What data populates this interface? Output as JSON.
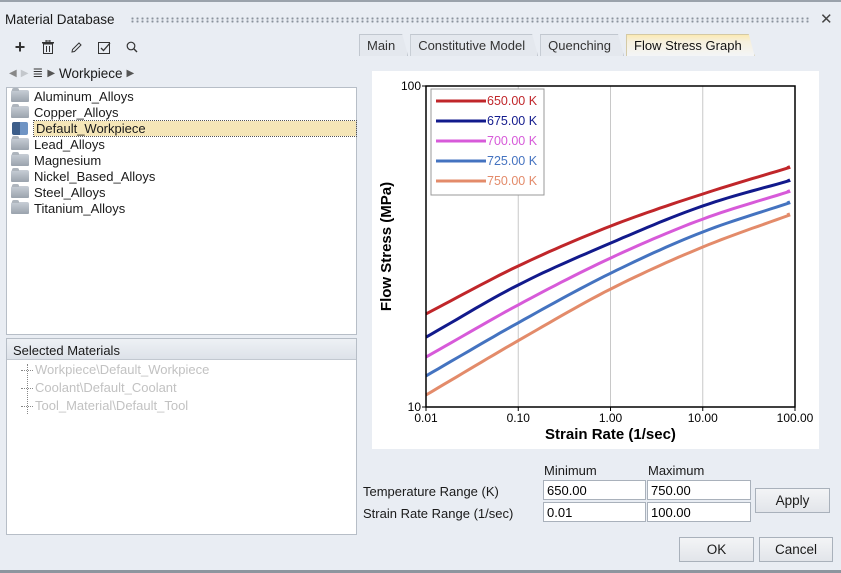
{
  "window": {
    "title": "Material Database",
    "close_icon": "close-icon"
  },
  "toolbar": {
    "buttons": [
      {
        "name": "add-button",
        "icon": "plus-icon",
        "glyph": "+"
      },
      {
        "name": "delete-button",
        "icon": "trash-icon",
        "glyph": "🗑"
      },
      {
        "name": "edit-button",
        "icon": "pencil-icon",
        "glyph": "✎"
      },
      {
        "name": "check-button",
        "icon": "checkbox-icon",
        "glyph": "☑"
      },
      {
        "name": "search-button",
        "icon": "search-icon",
        "glyph": "⌕"
      }
    ]
  },
  "navigation": {
    "back_glyph": "◆",
    "forward_glyph": "◆",
    "list_glyph": "≣",
    "arrow_glyph": "▶",
    "crumb": "Workpiece"
  },
  "tree": {
    "items": [
      {
        "label": "Aluminum_Alloys",
        "icon": "folder",
        "selected": false
      },
      {
        "label": "Copper_Alloys",
        "icon": "folder",
        "selected": false
      },
      {
        "label": "Default_Workpiece",
        "icon": "cube",
        "selected": true
      },
      {
        "label": "Lead_Alloys",
        "icon": "folder",
        "selected": false
      },
      {
        "label": "Magnesium",
        "icon": "folder",
        "selected": false
      },
      {
        "label": "Nickel_Based_Alloys",
        "icon": "folder",
        "selected": false
      },
      {
        "label": "Steel_Alloys",
        "icon": "folder",
        "selected": false
      },
      {
        "label": "Titanium_Alloys",
        "icon": "folder",
        "selected": false
      }
    ]
  },
  "selected_materials": {
    "header": "Selected Materials",
    "items": [
      "Workpiece\\Default_Workpiece",
      "Coolant\\Default_Coolant",
      "Tool_Material\\Default_Tool"
    ]
  },
  "tabs": [
    {
      "label": "Main",
      "active": false
    },
    {
      "label": "Constitutive Model",
      "active": false
    },
    {
      "label": "Quenching",
      "active": false
    },
    {
      "label": "Flow Stress Graph",
      "active": true
    }
  ],
  "chart_data": {
    "type": "line",
    "xscale": "log",
    "yscale": "log",
    "xlabel": "Strain Rate (1/sec)",
    "ylabel": "Flow Stress (MPa)",
    "xlim": [
      0.01,
      100
    ],
    "ylim": [
      10,
      100
    ],
    "xticks": [
      "0.01",
      "0.10",
      "1.00",
      "10.00",
      "100.00"
    ],
    "yticks": [
      "10",
      "100"
    ],
    "grid": "vertical",
    "legend": "top-left",
    "x": [
      0.01,
      0.1,
      1,
      10,
      100
    ],
    "series": [
      {
        "name": "650.00 K",
        "color": "#c0262a",
        "values": [
          19.5,
          27.5,
          36.6,
          46.1,
          56.4
        ]
      },
      {
        "name": "675.00 K",
        "color": "#121a8c",
        "values": [
          16.5,
          24.0,
          32.4,
          42.3,
          51.3
        ]
      },
      {
        "name": "700.00 K",
        "color": "#d75ad9",
        "values": [
          14.3,
          20.8,
          29.1,
          38.5,
          47.5
        ]
      },
      {
        "name": "725.00 K",
        "color": "#4473c0",
        "values": [
          12.5,
          18.3,
          26.1,
          35.1,
          43.8
        ]
      },
      {
        "name": "750.00 K",
        "color": "#e38b6a",
        "values": [
          10.9,
          16.1,
          23.3,
          31.5,
          40.2
        ]
      }
    ]
  },
  "controls": {
    "minimum_label": "Minimum",
    "maximum_label": "Maximum",
    "temperature_label": "Temperature Range (K)",
    "strain_rate_label": "Strain Rate Range (1/sec)",
    "temperature_min": "650.00",
    "temperature_max": "750.00",
    "strain_rate_min": "0.01",
    "strain_rate_max": "100.00",
    "apply_label": "Apply",
    "ok_label": "OK",
    "cancel_label": "Cancel"
  }
}
